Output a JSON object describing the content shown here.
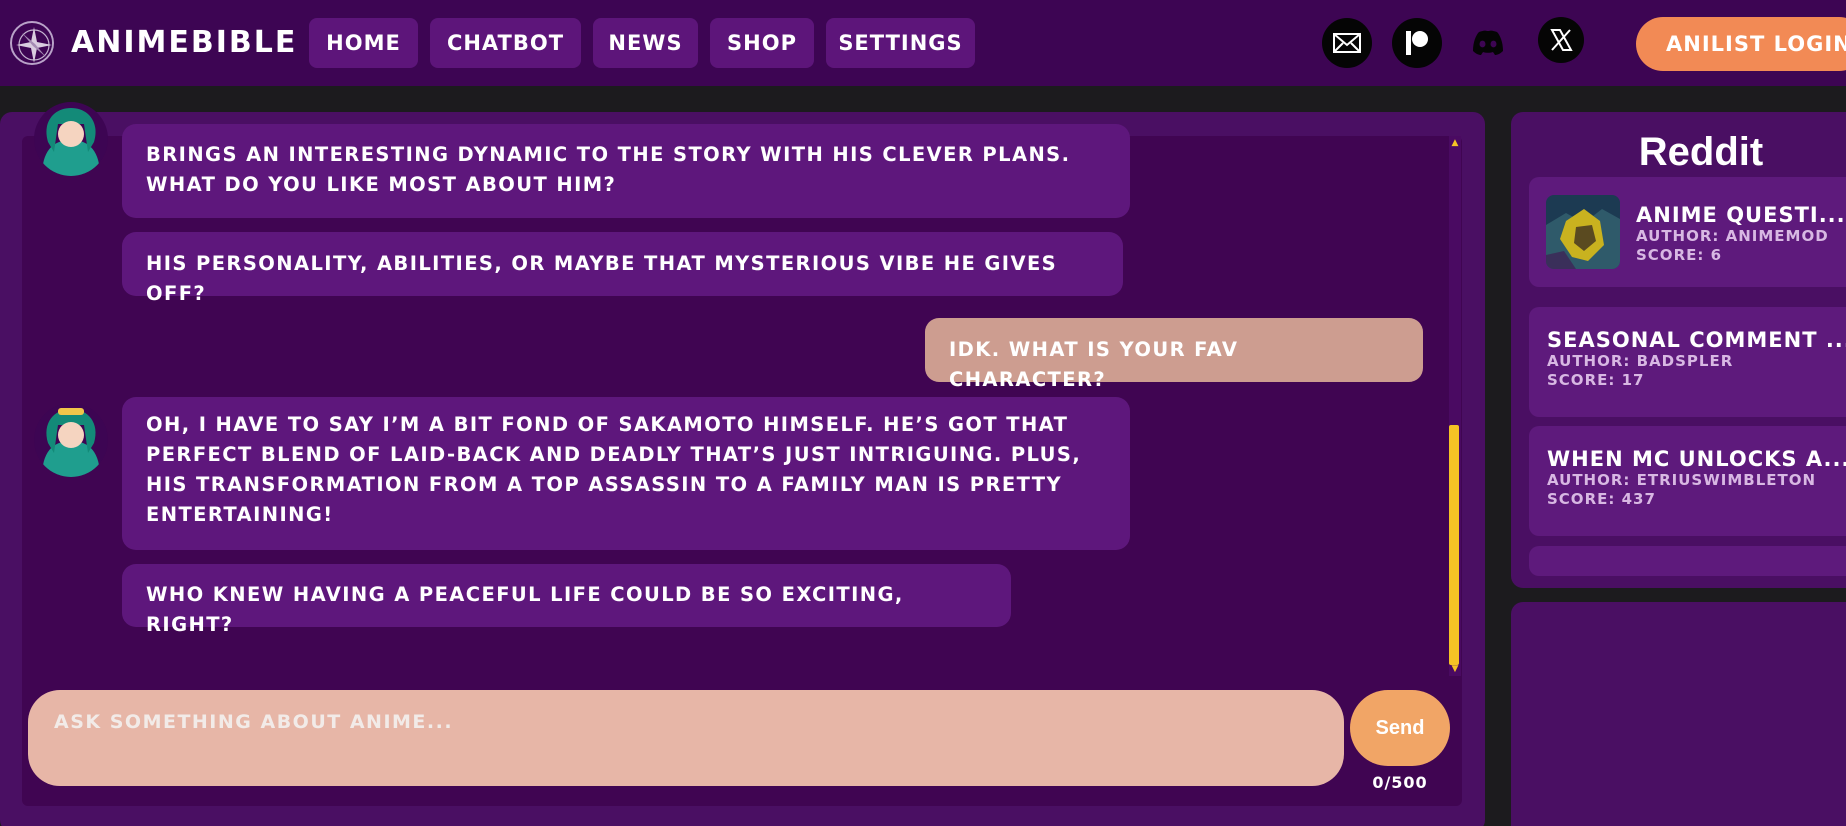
{
  "header": {
    "brand": "ANIMEBIBLE",
    "nav": [
      {
        "label": "HOME"
      },
      {
        "label": "CHATBOT"
      },
      {
        "label": "NEWS"
      },
      {
        "label": "SHOP"
      },
      {
        "label": "SETTINGS"
      }
    ],
    "socials": [
      "mail-icon",
      "patreon-icon",
      "discord-icon",
      "x-icon"
    ],
    "login_label": "ANILIST LOGIN"
  },
  "chat": {
    "messages": [
      {
        "from": "bot",
        "text": "BRINGS AN INTERESTING DYNAMIC TO THE STORY WITH HIS CLEVER PLANS. WHAT DO YOU LIKE MOST ABOUT HIM?"
      },
      {
        "from": "bot",
        "text": "HIS PERSONALITY, ABILITIES, OR MAYBE THAT MYSTERIOUS VIBE HE GIVES OFF?"
      },
      {
        "from": "user",
        "text": "IDK. WHAT IS YOUR FAV CHARACTER?"
      },
      {
        "from": "bot",
        "text": "OH, I HAVE TO SAY I’M A BIT FOND OF SAKAMOTO HIMSELF. HE’S GOT THAT PERFECT BLEND OF LAID-BACK AND DEADLY THAT’S JUST INTRIGUING. PLUS, HIS TRANSFORMATION FROM A TOP ASSASSIN TO A FAMILY MAN IS PRETTY ENTERTAINING!"
      },
      {
        "from": "bot",
        "text": "WHO KNEW HAVING A PEACEFUL LIFE COULD BE SO EXCITING, RIGHT?"
      }
    ],
    "input_placeholder": "ASK SOMETHING ABOUT ANIME...",
    "send_label": "Send",
    "counter": "0/500"
  },
  "reddit": {
    "title": "Reddit",
    "posts": [
      {
        "title": "ANIME QUESTI...",
        "author": "AUTHOR: ANIMEMOD",
        "score": "SCORE: 6"
      },
      {
        "title": "SEASONAL COMMENT ...",
        "author": "AUTHOR: BADSPLER",
        "score": "SCORE: 17"
      },
      {
        "title": "WHEN MC UNLOCKS A...",
        "author": "AUTHOR: ETRIUSWIMBLETON",
        "score": "SCORE: 437"
      }
    ]
  },
  "colors": {
    "nav_bg": "#3d0553",
    "panel_bg": "#4a0f63",
    "bubble_bot": "#5e177c",
    "bubble_user": "#cd9d90",
    "accent_orange": "#f28a55",
    "scroll_thumb": "#f5c325"
  }
}
